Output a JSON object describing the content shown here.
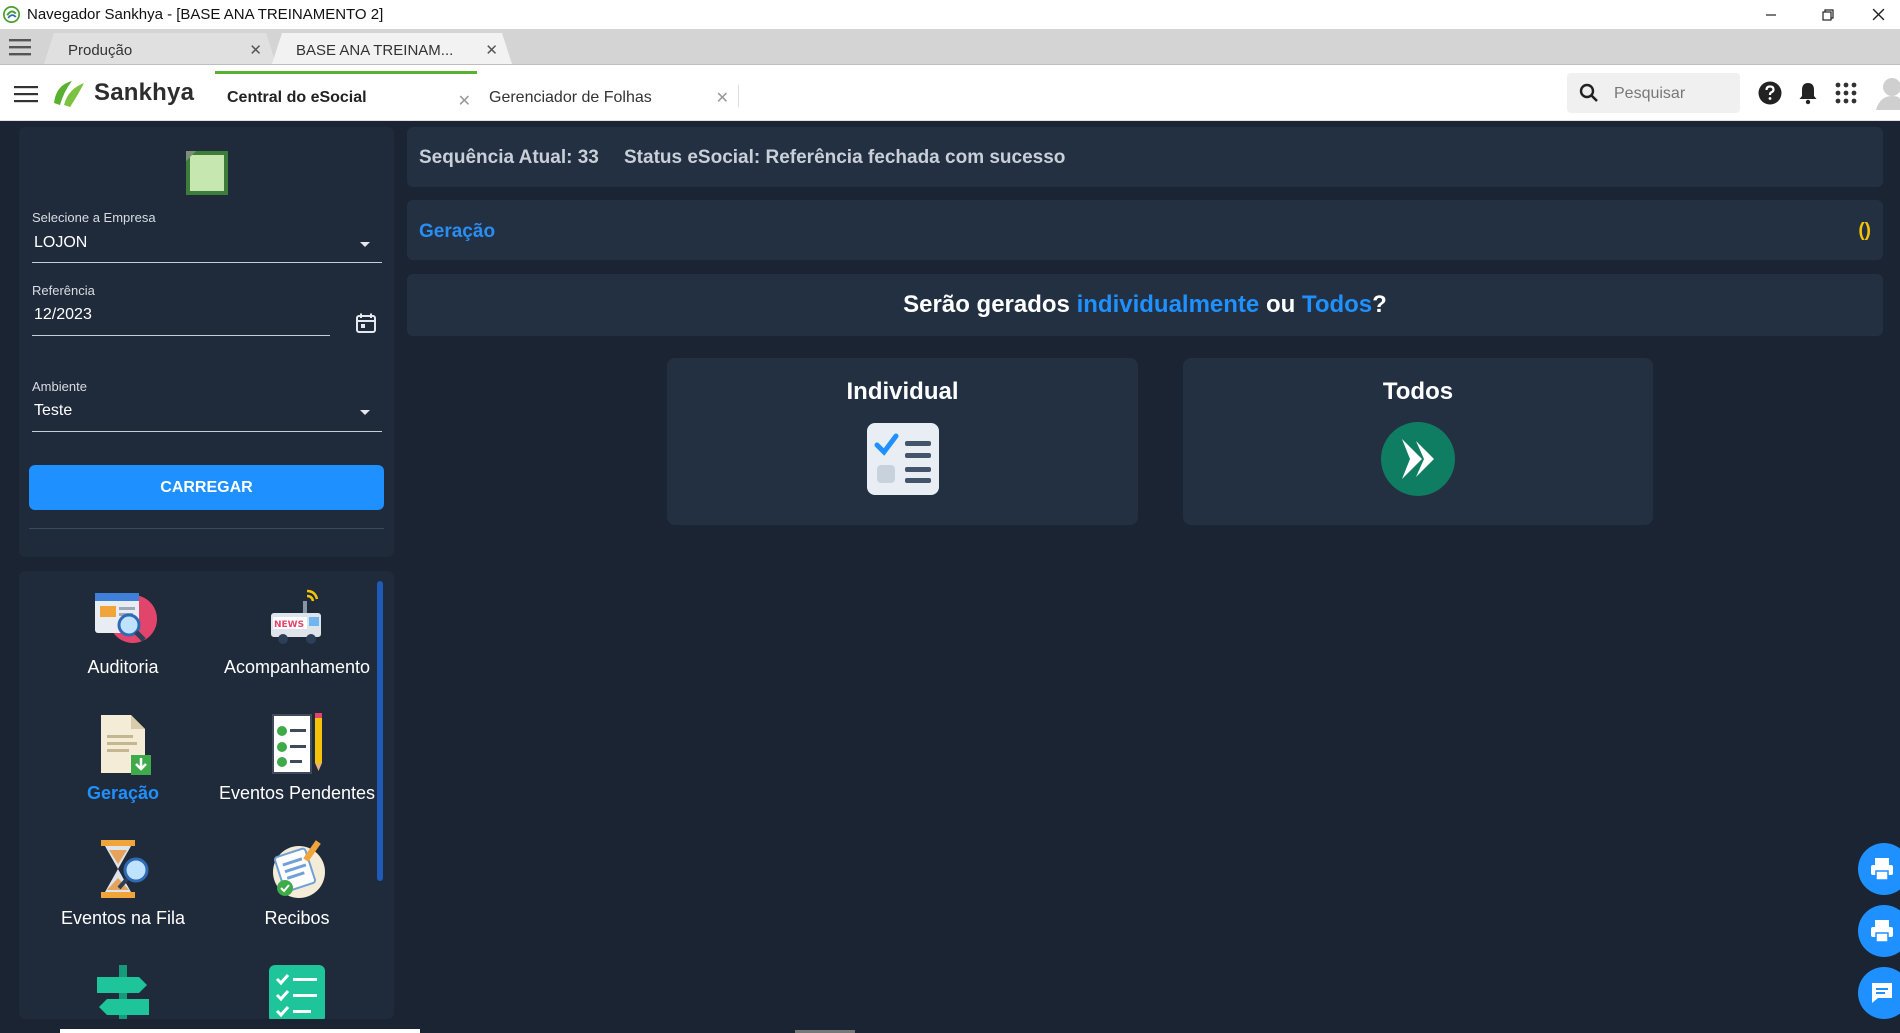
{
  "window": {
    "title": "Navegador Sankhya - [BASE ANA TREINAMENTO 2]"
  },
  "browser_tabs": [
    {
      "label": "Produção"
    },
    {
      "label": "BASE ANA TREINAM..."
    }
  ],
  "header": {
    "brand": "Sankhya",
    "tabs": [
      {
        "label": "Central do eSocial"
      },
      {
        "label": "Gerenciador de Folhas"
      }
    ],
    "search_placeholder": "Pesquisar"
  },
  "form": {
    "empresa_label": "Selecione a Empresa",
    "empresa_value": "LOJON",
    "referencia_label": "Referência",
    "referencia_value": "12/2023",
    "ambiente_label": "Ambiente",
    "ambiente_value": "Teste",
    "load_button": "CARREGAR"
  },
  "menu": {
    "items": [
      {
        "label": "Auditoria"
      },
      {
        "label": "Acompanhamento"
      },
      {
        "label": "Geração"
      },
      {
        "label": "Eventos Pendentes"
      },
      {
        "label": "Eventos na Fila"
      },
      {
        "label": "Recibos"
      }
    ]
  },
  "status": {
    "sequencia": "Sequência Atual: 33",
    "status_text": "Status eSocial: Referência fechada com sucesso"
  },
  "section": {
    "title": "Geração",
    "count": "()"
  },
  "question": {
    "part1": "Serão gerados ",
    "highlight1": "individualmente",
    "part2": " ou ",
    "highlight2": "Todos",
    "part3": "?"
  },
  "options": [
    {
      "label": "Individual"
    },
    {
      "label": "Todos"
    }
  ],
  "colors": {
    "accent": "#1e90ff",
    "brand_green": "#5ab031",
    "background": "#1a2433",
    "card": "#223042",
    "warning": "#f5c20a"
  }
}
